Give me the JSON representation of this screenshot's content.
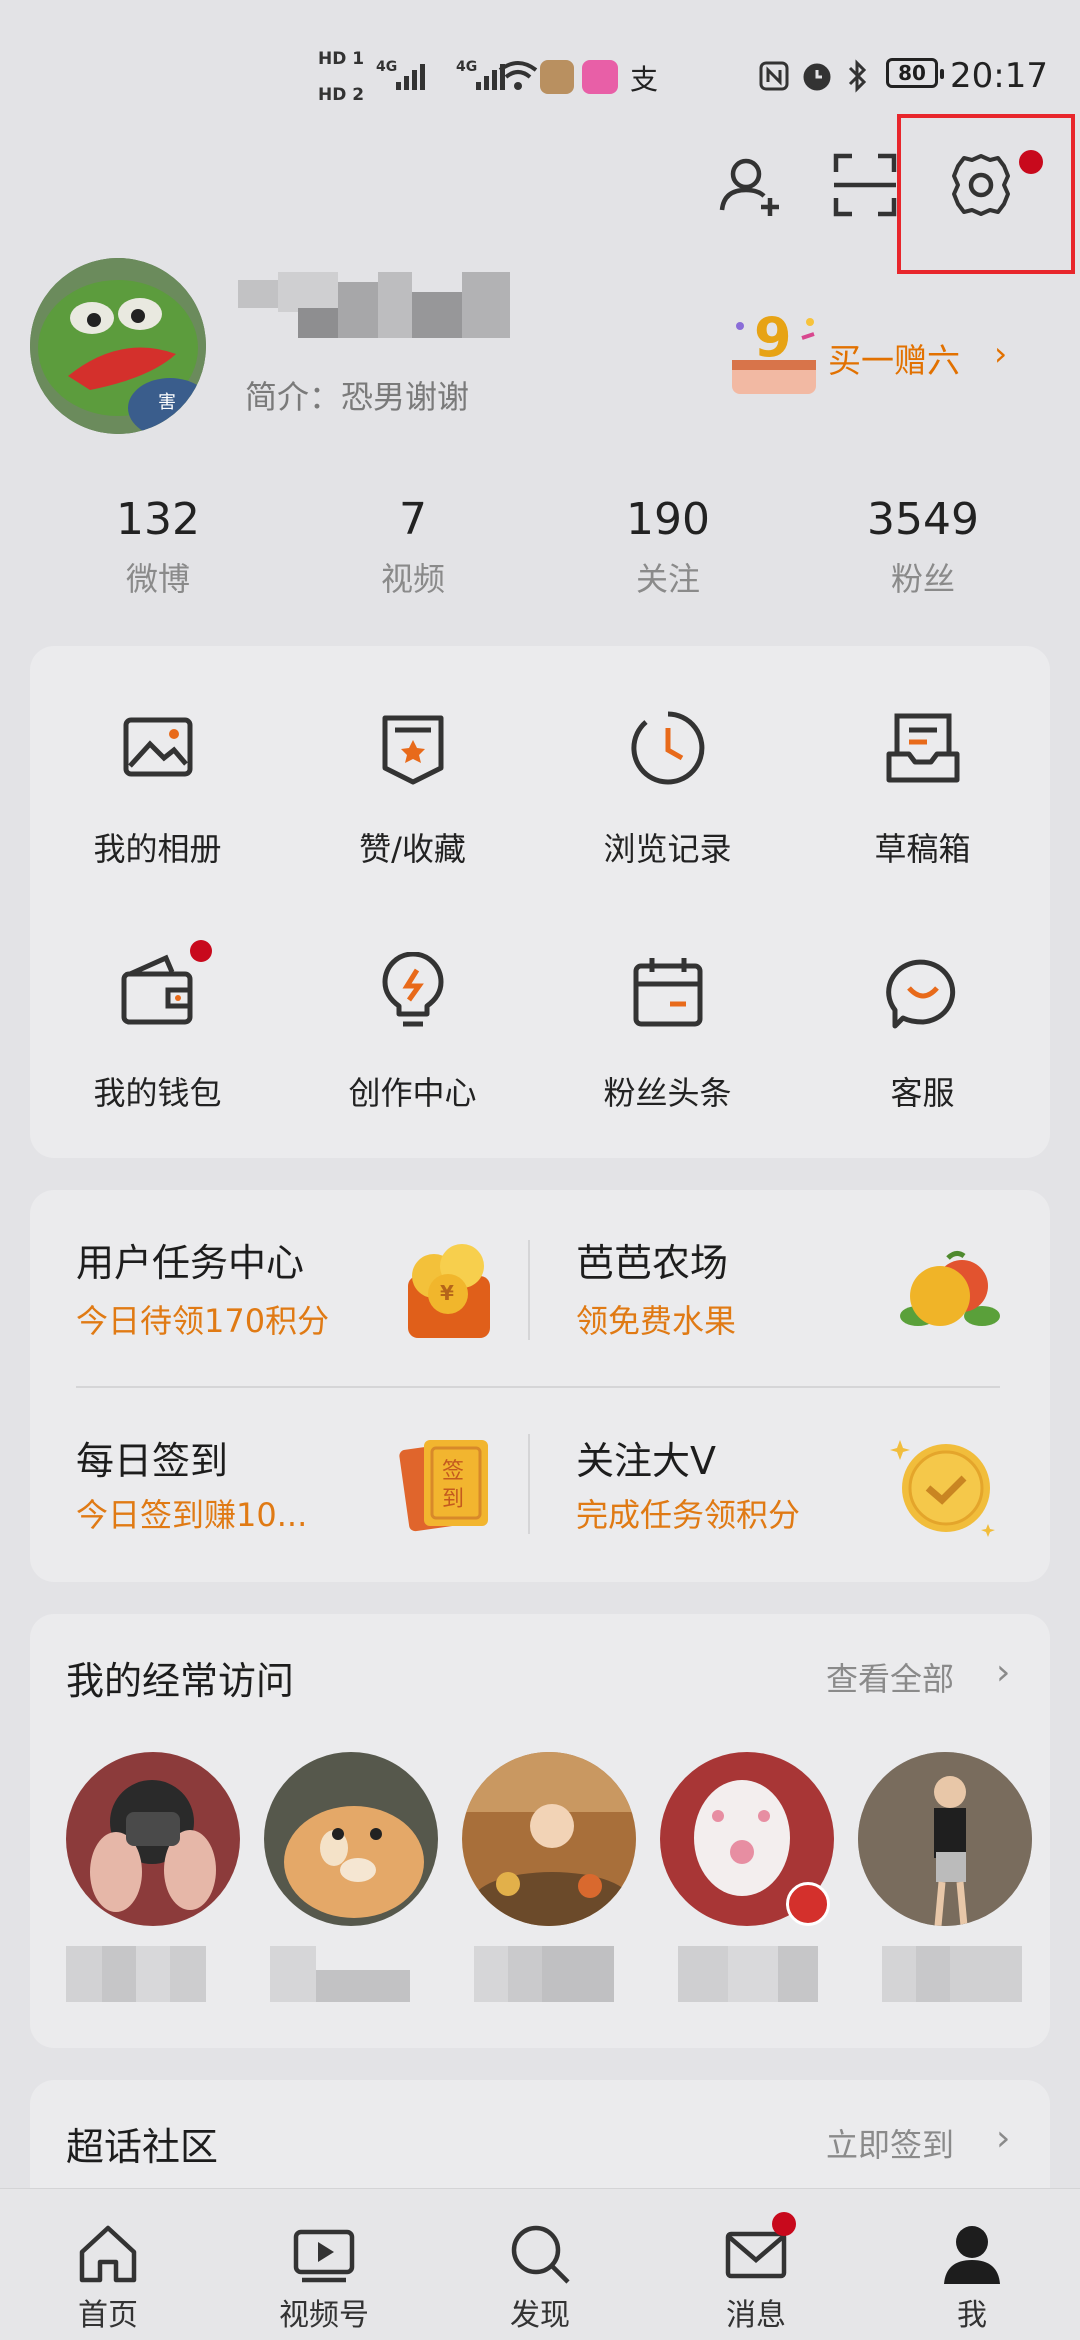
{
  "status_bar": {
    "hd1": "HD 1",
    "hd2": "HD 2",
    "net1": "4G",
    "net2": "4G",
    "battery": "80",
    "time": "20:17"
  },
  "profile": {
    "bio": "简介：恐男谢谢",
    "promo": "买一赠六",
    "promo_chevron": "›"
  },
  "stats": [
    {
      "value": "132",
      "label": "微博"
    },
    {
      "value": "7",
      "label": "视频"
    },
    {
      "value": "190",
      "label": "关注"
    },
    {
      "value": "3549",
      "label": "粉丝"
    }
  ],
  "grid": [
    {
      "label": "我的相册",
      "icon": "photo-album-icon"
    },
    {
      "label": "赞/收藏",
      "icon": "favorite-icon"
    },
    {
      "label": "浏览记录",
      "icon": "history-icon"
    },
    {
      "label": "草稿箱",
      "icon": "drafts-icon"
    },
    {
      "label": "我的钱包",
      "icon": "wallet-icon"
    },
    {
      "label": "创作中心",
      "icon": "lightbulb-icon"
    },
    {
      "label": "粉丝头条",
      "icon": "calendar-icon"
    },
    {
      "label": "客服",
      "icon": "chat-icon"
    }
  ],
  "tasks": [
    {
      "title": "用户任务中心",
      "sub": "今日待领170积分"
    },
    {
      "title": "芭芭农场",
      "sub": "领免费水果"
    },
    {
      "title": "每日签到",
      "sub": "今日签到赚10..."
    },
    {
      "title": "关注大V",
      "sub": "完成任务领积分"
    }
  ],
  "frequent": {
    "title": "我的经常访问",
    "link": "查看全部",
    "chevron": "›"
  },
  "super_topic": {
    "title": "超话社区",
    "link": "立即签到",
    "chevron": "›"
  },
  "nav": [
    {
      "label": "首页",
      "icon": "home-icon"
    },
    {
      "label": "视频号",
      "icon": "video-icon"
    },
    {
      "label": "发现",
      "icon": "search-icon"
    },
    {
      "label": "消息",
      "icon": "mail-icon"
    },
    {
      "label": "我",
      "icon": "profile-icon"
    }
  ],
  "colors": {
    "accent": "#e27100",
    "alert": "#c8091c",
    "highlight": "#e8262c"
  }
}
